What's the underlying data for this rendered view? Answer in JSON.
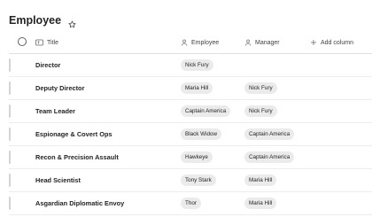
{
  "page": {
    "title": "Employee"
  },
  "columns": {
    "title": "Title",
    "employee": "Employee",
    "manager": "Manager",
    "add": "Add column"
  },
  "rows": [
    {
      "title": "Director",
      "employee": "Nick Fury",
      "manager": ""
    },
    {
      "title": "Deputy Director",
      "employee": "Maria Hill",
      "manager": "Nick Fury"
    },
    {
      "title": "Team Leader",
      "employee": "Captain America",
      "manager": "Nick Fury"
    },
    {
      "title": "Espionage & Covert Ops",
      "employee": "Black Widow",
      "manager": "Captain America"
    },
    {
      "title": "Recon & Precision Assault",
      "employee": "Hawkeye",
      "manager": "Captain America"
    },
    {
      "title": "Head Scientist",
      "employee": "Tony Stark",
      "manager": "Maria Hill"
    },
    {
      "title": "Asgardian Diplomatic Envoy",
      "employee": "Thor",
      "manager": "Maria Hill"
    }
  ],
  "icons": {
    "favorite": "star-outline-icon",
    "select_all": "circle-checkbox-icon",
    "title_column": "text-field-icon",
    "person_column": "person-icon",
    "add": "plus-icon"
  },
  "colors": {
    "pill_background": "#ebebeb",
    "text": "#242424"
  }
}
